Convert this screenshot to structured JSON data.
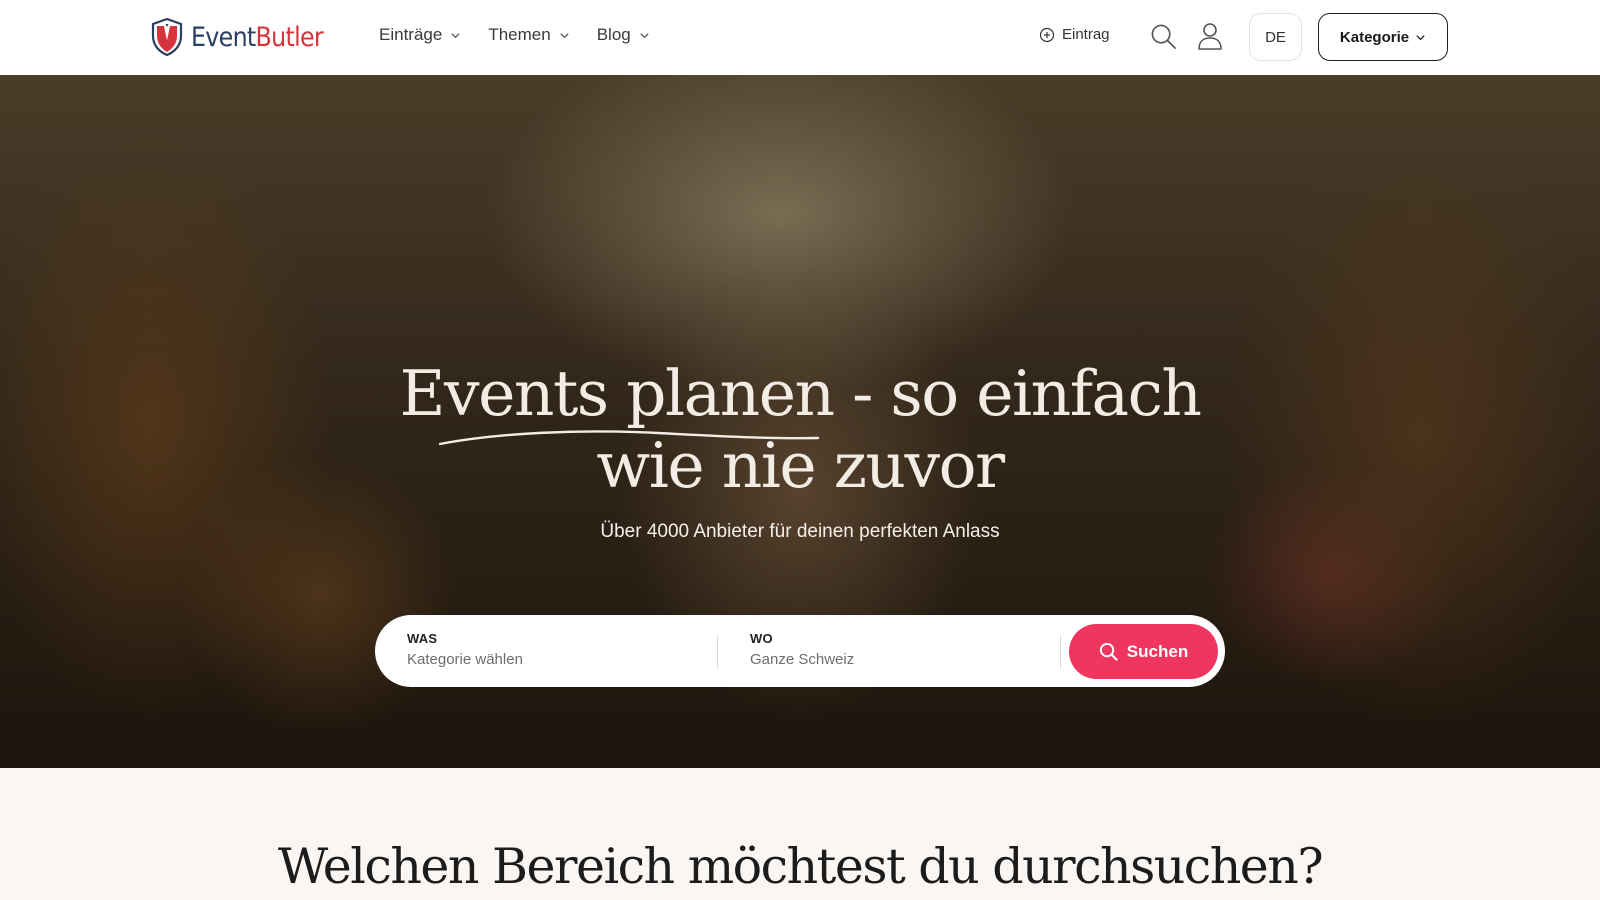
{
  "header": {
    "logo": {
      "part1": "Event",
      "part2": "Butler"
    },
    "nav": [
      {
        "label": "Einträge"
      },
      {
        "label": "Themen"
      },
      {
        "label": "Blog"
      }
    ],
    "add_entry_label": "Eintrag",
    "language": "DE",
    "category_button": "Kategorie"
  },
  "hero": {
    "title_line1": "Events planen - so einfach",
    "title_line2": "wie nie zuvor",
    "subtitle": "Über 4000 Anbieter für deinen perfekten Anlass",
    "search": {
      "what_label": "WAS",
      "what_placeholder": "Kategorie wählen",
      "where_label": "WO",
      "where_placeholder": "Ganze Schweiz",
      "button_label": "Suchen"
    }
  },
  "section": {
    "title": "Welchen Bereich möchtest du durchsuchen?"
  },
  "colors": {
    "brand_navy": "#2a3f63",
    "brand_red": "#d6343c",
    "search_button": "#f0355f"
  },
  "icons": [
    "logo-shield-icon",
    "chevron-down-icon",
    "plus-circle-icon",
    "search-icon",
    "user-icon"
  ]
}
